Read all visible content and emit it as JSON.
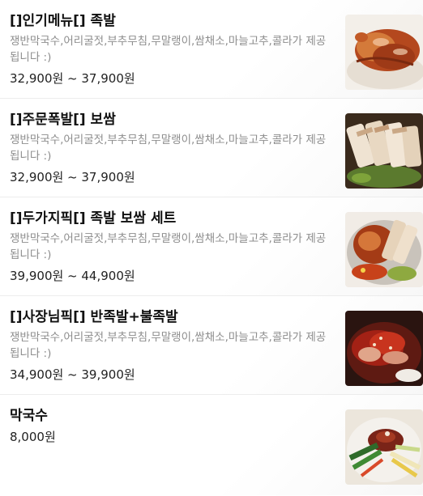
{
  "menu": {
    "items": [
      {
        "name": "[]인기메뉴[] 족발",
        "description": "쟁반막국수,어리굴젓,부추무침,무말랭이,쌈채소,마늘고추,콜라가 제공됩니다 :)",
        "price": "32,900원 ~ 37,900원",
        "image": "jokbal-photo"
      },
      {
        "name": "[]주문폭발[] 보쌈",
        "description": "쟁반막국수,어리굴젓,부추무침,무말랭이,쌈채소,마늘고추,콜라가 제공됩니다 :)",
        "price": "32,900원 ~ 37,900원",
        "image": "bossam-photo"
      },
      {
        "name": "[]두가지픽[] 족발 보쌈 세트",
        "description": "쟁반막국수,어리굴젓,부추무침,무말랭이,쌈채소,마늘고추,콜라가 제공됩니다 :)",
        "price": "39,900원 ~ 44,900원",
        "image": "jokbal-bossam-set-photo"
      },
      {
        "name": "[]사장님픽[] 반족발+불족발",
        "description": "쟁반막국수,어리굴젓,부추무침,무말랭이,쌈채소,마늘고추,콜라가 제공됩니다 :)",
        "price": "34,900원 ~ 39,900원",
        "image": "half-jokbal-spicy-jokbal-photo"
      },
      {
        "name": "막국수",
        "description": "",
        "price": "8,000원",
        "image": "makguksu-photo"
      }
    ]
  }
}
